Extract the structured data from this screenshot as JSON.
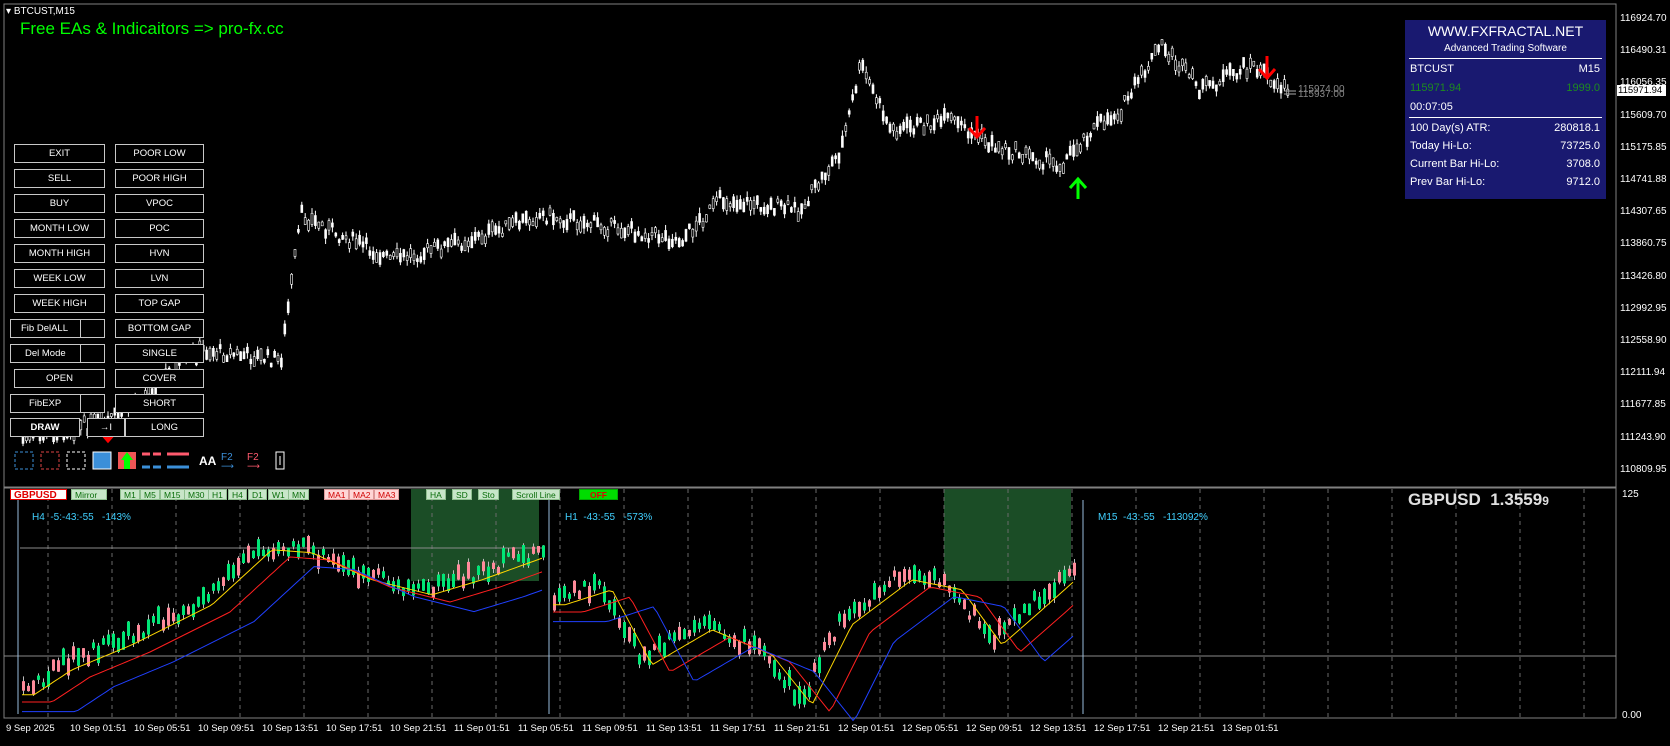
{
  "window": {
    "symbol_title": "BTCUST,M15",
    "promo_text": "Free EAs & Indicaitors => pro-fx.cc"
  },
  "colors": {
    "up_candle": "#ffffff",
    "price_text": "#ffffff",
    "promo": "#00ff00",
    "panel_bg": "#191970",
    "buy_arrow": "#00ff00",
    "sell_arrow": "#ff0000",
    "zone": "#1b4d26"
  },
  "price_axis": {
    "labels": [
      "116924.70",
      "116490.31",
      "116056.35",
      "115609.70",
      "115175.85",
      "114741.88",
      "114307.65",
      "113860.75",
      "113426.80",
      "112992.95",
      "112558.90",
      "112111.94",
      "111677.85",
      "111243.90",
      "110809.95"
    ],
    "current_price": "115971.94",
    "line_labels": [
      "115974.00",
      "115937.00"
    ]
  },
  "time_axis": {
    "labels": [
      "9 Sep 2025",
      "10 Sep 01:51",
      "10 Sep 05:51",
      "10 Sep 09:51",
      "10 Sep 13:51",
      "10 Sep 17:51",
      "10 Sep 21:51",
      "11 Sep 01:51",
      "11 Sep 05:51",
      "11 Sep 09:51",
      "11 Sep 13:51",
      "11 Sep 17:51",
      "11 Sep 21:51",
      "12 Sep 01:51",
      "12 Sep 05:51",
      "12 Sep 09:51",
      "12 Sep 13:51",
      "12 Sep 17:51",
      "12 Sep 21:51",
      "13 Sep 01:51"
    ]
  },
  "info_panel": {
    "site": "WWW.FXFRACTAL.NET",
    "subtitle": "Advanced Trading Software",
    "symbol": "BTCUST",
    "timeframe": "M15",
    "bid": "115971.94",
    "spread": "1999.0",
    "timer": "00:07:05",
    "rows": [
      {
        "label": "100 Day(s) ATR:",
        "value": "280818.1"
      },
      {
        "label": "Today Hi-Lo:",
        "value": "73725.0"
      },
      {
        "label": "Current Bar Hi-Lo:",
        "value": "3708.0"
      },
      {
        "label": "Prev Bar Hi-Lo:",
        "value": "9712.0"
      }
    ]
  },
  "buttons": {
    "left": [
      "EXIT",
      "SELL",
      "BUY",
      "MONTH LOW",
      "MONTH HIGH",
      "WEEK LOW",
      "WEEK HIGH",
      "Fib DelALL",
      "Del Mode",
      "OPEN",
      "FibEXP",
      "DRAW"
    ],
    "right": [
      "POOR LOW",
      "POOR HIGH",
      "VPOC",
      "POC",
      "HVN",
      "LVN",
      "TOP GAP",
      "BOTTOM GAP",
      "SINGLE",
      "COVER",
      "SHORT",
      "LONG"
    ],
    "tab_arrow": "→I"
  },
  "draw_toolbar": {
    "font_tool": "AA",
    "f2_blue": "F2",
    "f2_red": "F2"
  },
  "subwindow": {
    "symbol_button": "GBPUSD",
    "mirror": "Mirror",
    "timeframes": [
      "M1",
      "M5",
      "M15",
      "M30",
      "H1",
      "H4",
      "D1",
      "W1",
      "MN"
    ],
    "ma_buttons": [
      "MA1",
      "MA2",
      "MA3"
    ],
    "tools": [
      "HA",
      "SD",
      "Sto",
      "Scroll Line"
    ],
    "toggle": "OFF",
    "quote_symbol": "GBPUSD",
    "quote_price": "1.3559",
    "quote_small": "9",
    "axis_top": "125",
    "axis_bottom": "0.00",
    "panels": [
      {
        "label": "H4  -5:-43:-55   -143%"
      },
      {
        "label": "H1  -43:-55   -573%"
      },
      {
        "label": "M15  -43:-55   -113092%"
      }
    ]
  }
}
